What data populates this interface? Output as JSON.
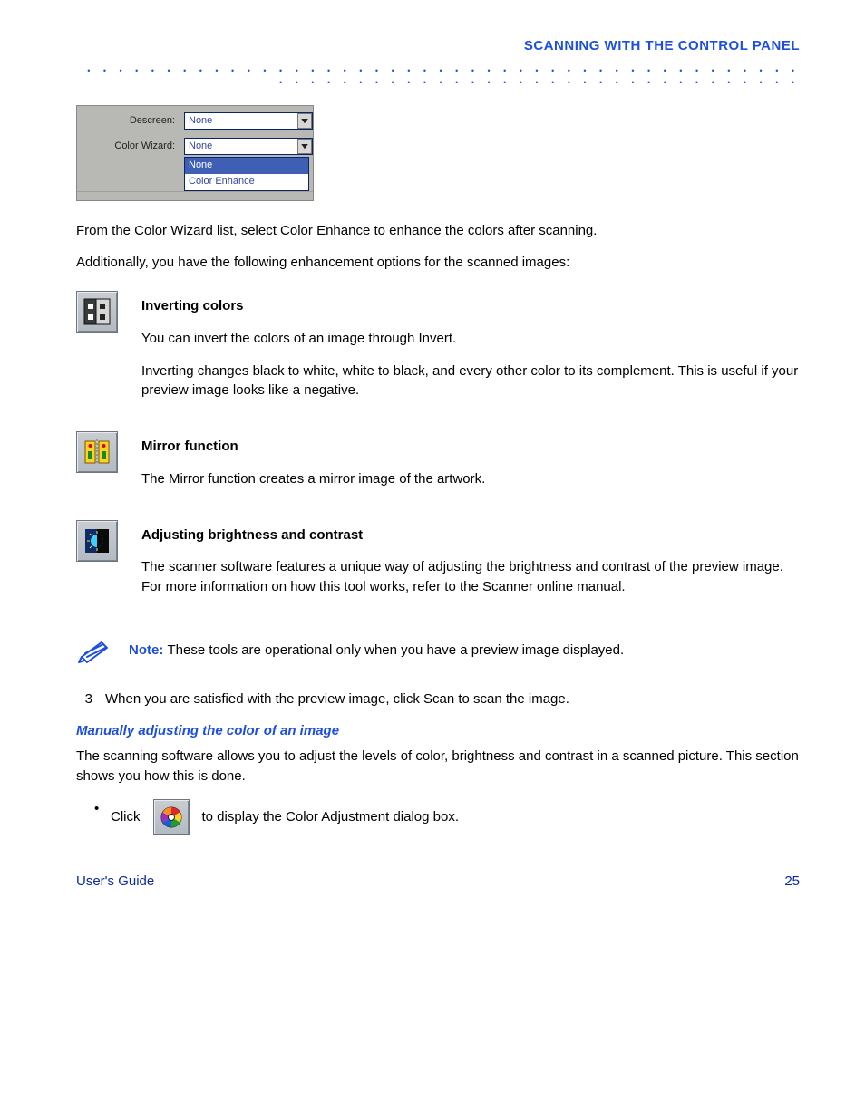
{
  "header": {
    "title": "SCANNING WITH THE CONTROL PANEL"
  },
  "panelshot": {
    "row1_label": "Descreen:",
    "row1_value": "None",
    "row2_label": "Color Wizard:",
    "row2_value": "None",
    "options": [
      "None",
      "Color Enhance"
    ]
  },
  "intro1": "From the Color Wizard list, select Color Enhance to enhance the colors after scanning.",
  "intro2": "Additionally, you have the following enhancement options for the scanned images:",
  "tools": [
    {
      "icon": "invert-icon",
      "title": "Inverting colors",
      "p1": "You can invert the colors of an image through Invert.",
      "p2": "Inverting changes black to white, white to black, and every other color to its complement. This is useful if your preview image looks like a negative."
    },
    {
      "icon": "mirror-vertical-icon",
      "title": "Mirror function",
      "p1": "The Mirror function creates a mirror image of the artwork."
    },
    {
      "icon": "brightness-contrast-icon",
      "title": "Adjusting brightness and contrast",
      "p1": "The scanner software features a unique way of adjusting the brightness and contrast of the preview image. For more information on how this tool works, refer to the Scanner online manual."
    }
  ],
  "note": {
    "label": "Note: ",
    "text": "These tools are operational only when you have a preview image displayed."
  },
  "step3": {
    "num": "3",
    "text": "When you are satisfied with the preview image, click Scan to scan the image."
  },
  "subhead": "Manually adjusting the color of an image",
  "subtext": "The scanning software allows you to adjust the levels of color, brightness and contrast in a scanned picture. This section shows you how this is done.",
  "adjustlist": {
    "item1_prefix": "Click ",
    "item1_rest": " to display the Color Adjustment dialog box."
  },
  "coloradj_icon": "color-wheel-icon",
  "footer": {
    "left": "User's Guide",
    "right": "25"
  }
}
